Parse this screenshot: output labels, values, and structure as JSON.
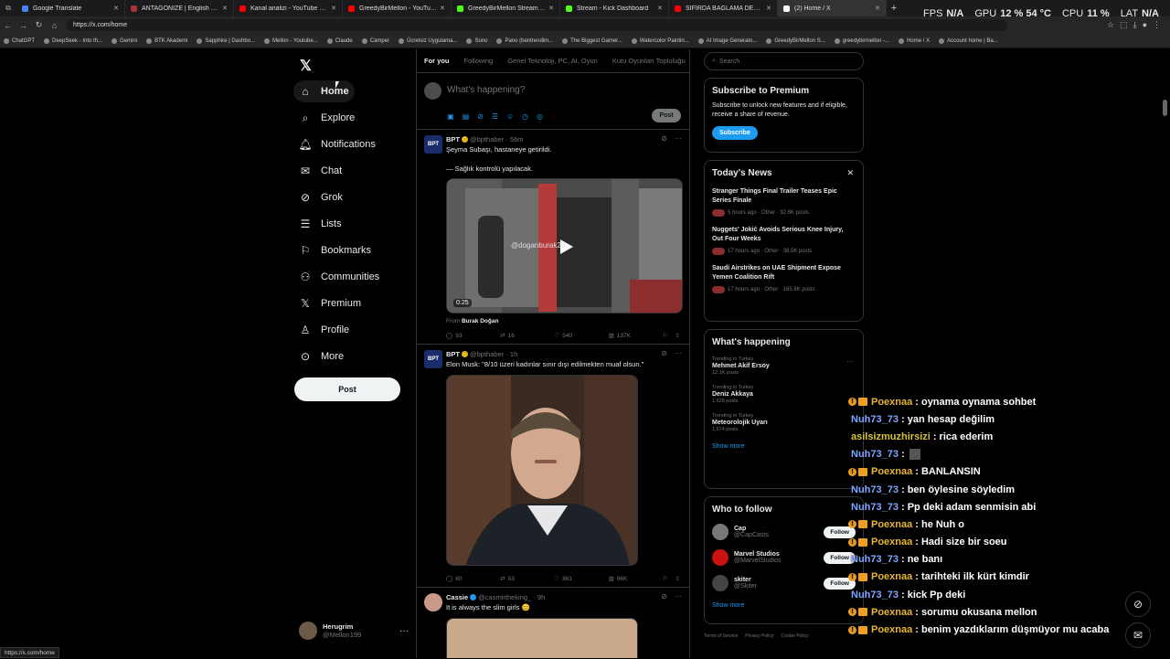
{
  "browser": {
    "tabs": [
      {
        "title": "Google Translate",
        "color": "#4285f4"
      },
      {
        "title": "ANTAGONIZE | English meaning -",
        "color": "#aa3333"
      },
      {
        "title": "Kanal analizi - YouTube Studio",
        "color": "#ff0000"
      },
      {
        "title": "GreedyBirMellon - YouTube",
        "color": "#ff0000"
      },
      {
        "title": "GreedyBirMellon Stream - Watch L",
        "color": "#53fc18"
      },
      {
        "title": "Stream - Kick Dashboard",
        "color": "#53fc18"
      },
      {
        "title": "SIFIRDA BAĞLAMA DERSİ 5 | Nota",
        "color": "#ff0000"
      },
      {
        "title": "(2) Home / X",
        "color": "#ffffff"
      }
    ],
    "url": "https://x.com/home",
    "hud": {
      "fps_label": "FPS",
      "fps": "N/A",
      "gpu_label": "GPU",
      "gpu": "12 % 54 °C",
      "cpu_label": "CPU",
      "cpu": "11 %",
      "lat_label": "LAT",
      "lat": "N/A"
    },
    "bookmarks": [
      "ChatGPT",
      "DeepSeek - Into th...",
      "Gemini",
      "BTK Akademi",
      "Sapphire | Dashbo...",
      "Mellon - Youtube...",
      "Claude",
      "Camper",
      "Ücretsiz Uygulama...",
      "Suno",
      "Pano (bentrendim...",
      "The Biggest Gamer...",
      "Watercolor Paintin...",
      "AI Image Generato...",
      "GreedyBirMellon S...",
      "greedybirmellon -...",
      "Home / X",
      "Account home | Ba..."
    ],
    "status_url": "https://x.com/home"
  },
  "nav": {
    "items": [
      {
        "label": "Home"
      },
      {
        "label": "Explore"
      },
      {
        "label": "Notifications"
      },
      {
        "label": "Chat"
      },
      {
        "label": "Grok"
      },
      {
        "label": "Lists"
      },
      {
        "label": "Bookmarks"
      },
      {
        "label": "Communities"
      },
      {
        "label": "Premium"
      },
      {
        "label": "Profile"
      },
      {
        "label": "More"
      }
    ],
    "post_label": "Post",
    "account": {
      "name": "Herugrim",
      "handle": "@Mellon199"
    }
  },
  "feed": {
    "tabs": [
      "For you",
      "Following",
      "Genel Teknoloji, PC, AI, Oyun",
      "Kutu Oyunları Topluluğu"
    ],
    "compose_placeholder": "What's happening?",
    "compose_post": "Post",
    "tweets": [
      {
        "avatar": "BPT",
        "name": "BPT",
        "handle": "@bpthaber",
        "time": "· 56m",
        "text1": "Şeyma Subaşı, hastaneye getirildi.",
        "text2": "— Sağlık kontrolü yapılacak.",
        "video_duration": "0:25",
        "watermark": "@doganburak29",
        "from_label": "From",
        "from_name": "Burak Doğan",
        "replies": "93",
        "reposts": "16",
        "likes": "540",
        "views": "137K"
      },
      {
        "avatar": "BPT",
        "name": "BPT",
        "handle": "@bpthaber",
        "time": "· 1h",
        "text1": "Elon Musk: \"8/10 üzeri kadınlar sınır dışı edilmekten muaf olsun.\"",
        "replies": "80",
        "reposts": "53",
        "likes": "861",
        "views": "96K"
      },
      {
        "name": "Cassie",
        "handle": "@casmirtheking_",
        "time": "· 9h",
        "text1": "It is always the slim girls 😊"
      }
    ]
  },
  "sidebar": {
    "search_placeholder": "Search",
    "premium": {
      "title": "Subscribe to Premium",
      "text": "Subscribe to unlock new features and if eligible, receive a share of revenue.",
      "button": "Subscribe"
    },
    "news": {
      "title": "Today's News",
      "items": [
        {
          "headline": "Stranger Things Final Trailer Teases Epic Series Finale",
          "meta": "5 hours ago · Other · 92.6K posts"
        },
        {
          "headline": "Nuggets' Jokić Avoids Serious Knee Injury, Out Four Weeks",
          "meta": "17 hours ago · Other · 38.5K posts"
        },
        {
          "headline": "Saudi Airstrikes on UAE Shipment Expose Yemen Coalition Rift",
          "meta": "17 hours ago · Other · 165.8K posts"
        }
      ]
    },
    "happening": {
      "title": "What's happening",
      "items": [
        {
          "context": "Trending in Turkey",
          "name": "Mehmet Akif Ersoy",
          "count": "12.1K posts"
        },
        {
          "context": "Trending in Turkey",
          "name": "Deniz Akkaya",
          "count": "1,628 posts"
        },
        {
          "context": "Trending in Turkey",
          "name": "Meteorolojik Uyarı",
          "count": "1,674 posts"
        }
      ],
      "show_more": "Show more"
    },
    "who": {
      "title": "Who to follow",
      "items": [
        {
          "name": "Cap",
          "handle": "@CapCasts",
          "btn": "Follow"
        },
        {
          "name": "Marvel Studios",
          "handle": "@MarvelStudios",
          "btn": "Follow"
        },
        {
          "name": "skiter",
          "handle": "@Skiter",
          "btn": "Follow"
        }
      ],
      "show_more": "Show more"
    },
    "footer": [
      "Terms of Service",
      "Privacy Policy",
      "Cookie Policy"
    ]
  },
  "chat_overlay": [
    {
      "user": "Poexnaa",
      "msg": ": oynama oynama sohbet",
      "style": "u1",
      "badges": true
    },
    {
      "user": "Nuh73_73",
      "msg": ": yan hesap değilim",
      "style": "u2",
      "badges": false
    },
    {
      "user": "asilsizmuzhirsizi",
      "msg": ": rica ederim",
      "style": "u3",
      "badges": false
    },
    {
      "user": "Nuh73_73",
      "msg": ":",
      "style": "u2",
      "badges": false
    },
    {
      "user": "Poexnaa",
      "msg": ": BANLANSIN",
      "style": "u1",
      "badges": true
    },
    {
      "user": "Nuh73_73",
      "msg": ": ben öylesine söyledim",
      "style": "u2",
      "badges": false
    },
    {
      "user": "Nuh73_73",
      "msg": ": Pp deki adam senmisin abi",
      "style": "u2",
      "badges": false
    },
    {
      "user": "Poexnaa",
      "msg": ": he Nuh o",
      "style": "u1",
      "badges": true
    },
    {
      "user": "Poexnaa",
      "msg": ": Hadi size bir soeu",
      "style": "u1",
      "badges": true
    },
    {
      "user": "Nuh73_73",
      "msg": ": ne banı",
      "style": "u2",
      "badges": false
    },
    {
      "user": "Poexnaa",
      "msg": ": tarihteki ilk kürt kimdir",
      "style": "u1",
      "badges": true
    },
    {
      "user": "Nuh73_73",
      "msg": ": kick Pp deki",
      "style": "u2",
      "badges": false
    },
    {
      "user": "Poexnaa",
      "msg": ": sorumu okusana mellon",
      "style": "u1",
      "badges": true
    },
    {
      "user": "Poexnaa",
      "msg": ": benim yazdıklarım düşmüyor mu acaba",
      "style": "u1",
      "badges": true
    }
  ]
}
